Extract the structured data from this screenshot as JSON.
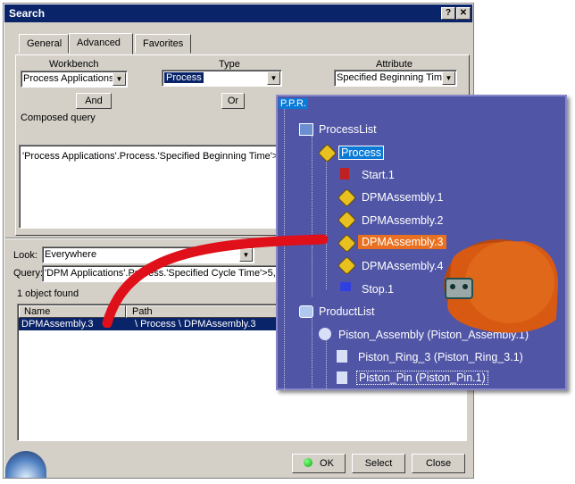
{
  "window": {
    "title": "Search",
    "help_btn": "?",
    "close_btn": "✕"
  },
  "tabs": [
    {
      "label": "General"
    },
    {
      "label": "Advanced"
    },
    {
      "label": "Favorites"
    }
  ],
  "advanced": {
    "workbench_label": "Workbench",
    "workbench_value": "Process Applications",
    "type_label": "Type",
    "type_value": "Process",
    "attribute_label": "Attribute",
    "attribute_value": "Specified Beginning Time",
    "and_button": "And",
    "or_button": "Or",
    "composed_query_label": "Composed query",
    "composed_query_text": "'Process Applications'.Process.'Specified Beginning Time'>5"
  },
  "search": {
    "look_label": "Look:",
    "look_value": "Everywhere",
    "query_label": "Query:",
    "query_value": "'DPM Applications'.Process.'Specified Cycle Time'>5,al",
    "found_text": "1 object found"
  },
  "results": {
    "columns": [
      "Name",
      "Path"
    ],
    "rows": [
      {
        "name": "DPMAssembly.3",
        "path": "\\ Process \\ DPMAssembly.3"
      }
    ]
  },
  "buttons": {
    "ok": "OK",
    "select": "Select",
    "close": "Close"
  },
  "tree": {
    "root": "P.P.R.",
    "items": [
      {
        "label": "ProcessList"
      },
      {
        "label": "Process"
      },
      {
        "label": "Start.1"
      },
      {
        "label": "DPMAssembly.1"
      },
      {
        "label": "DPMAssembly.2"
      },
      {
        "label": "DPMAssembly.3"
      },
      {
        "label": "DPMAssembly.4"
      },
      {
        "label": "Stop.1"
      },
      {
        "label": "ProductList"
      },
      {
        "label": "Piston_Assembly (Piston_Assembly.1)"
      },
      {
        "label": "Piston_Ring_3 (Piston_Ring_3.1)"
      },
      {
        "label": "Piston_Pin (Piston_Pin.1)"
      }
    ]
  },
  "colors": {
    "titlebar": "#0a246a",
    "tree_bg": "#5055a6",
    "highlight": "#e87020",
    "arrow": "#e0101a",
    "piston": "#d85a12"
  }
}
